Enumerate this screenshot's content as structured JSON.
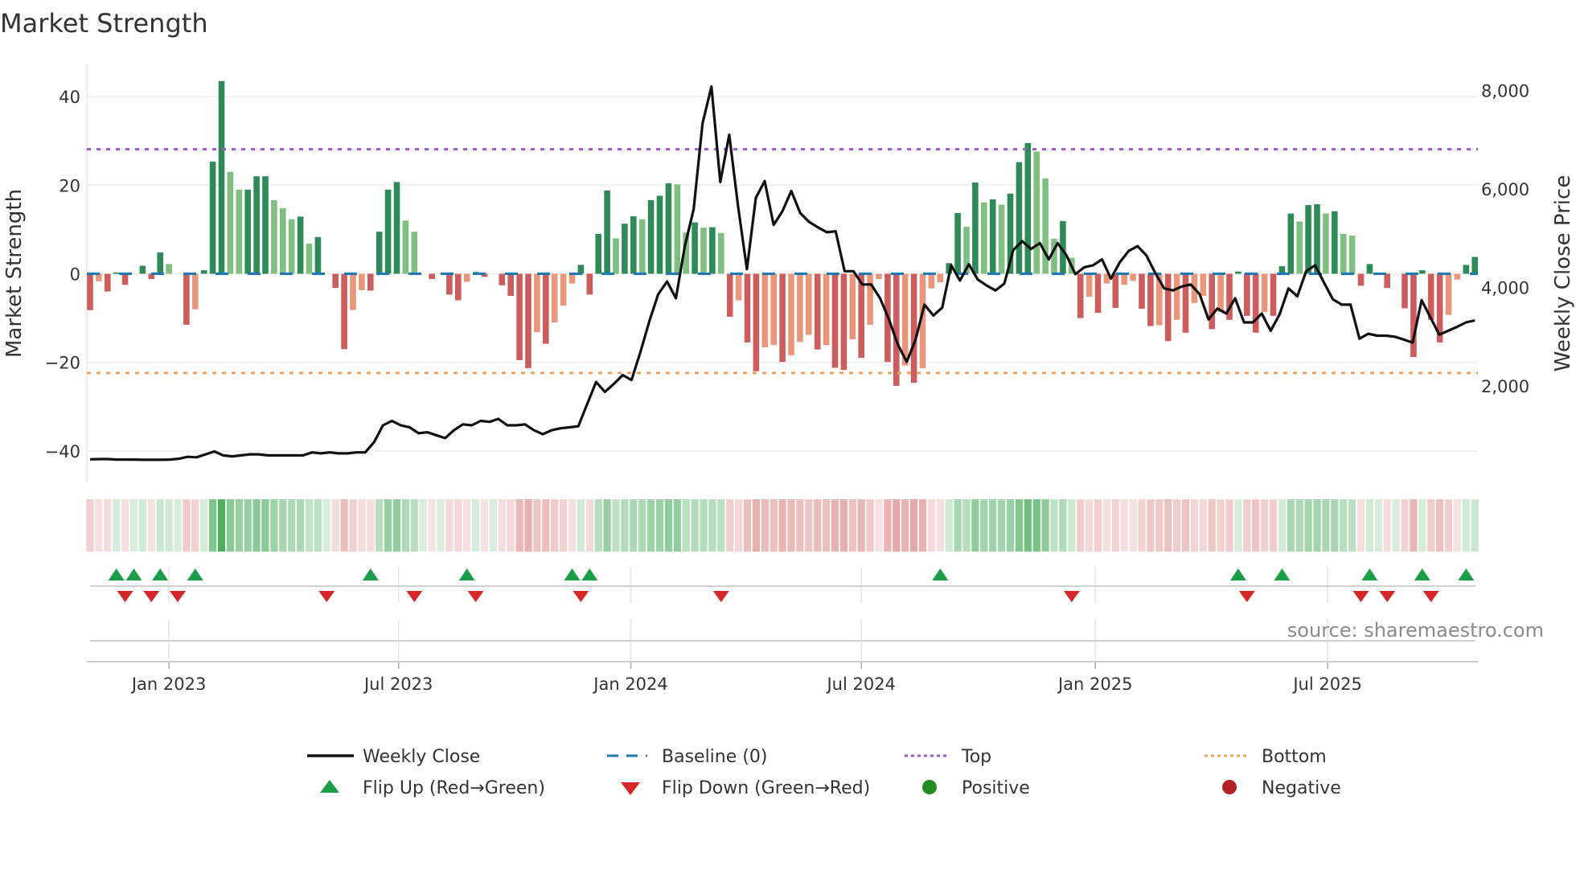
{
  "chart_data": {
    "type": "bar",
    "title": "Market Strength",
    "ylabel": "Market Strength",
    "y2label": "Weekly Close Price",
    "ylim": [
      -47,
      47
    ],
    "y2_ticks": [
      "8,000",
      "6,000",
      "4,000",
      "2,000"
    ],
    "y2_tick_values": [
      8000,
      6000,
      4000,
      2000
    ],
    "y_ticks": [
      "40",
      "20",
      "0",
      "−20",
      "−40"
    ],
    "y_tick_values": [
      40,
      20,
      0,
      -20,
      -40
    ],
    "x_ticks": [
      {
        "label": "Jan 2023",
        "week": 10
      },
      {
        "label": "Jul 2023",
        "week": 36.2
      },
      {
        "label": "Jan 2024",
        "week": 62.7
      },
      {
        "label": "Jul 2024",
        "week": 89
      },
      {
        "label": "Jan 2025",
        "week": 115.7
      },
      {
        "label": "Jul 2025",
        "week": 142.2
      }
    ],
    "top_level": 28.1,
    "bottom_level": -22.4,
    "strength": [
      -8.2,
      -1.7,
      -4,
      0.3,
      -2.5,
      0,
      1.8,
      -1.2,
      4.8,
      2.2,
      0,
      -11.5,
      -8,
      0.8,
      25.3,
      43.5,
      23,
      19,
      19,
      22,
      22,
      16.6,
      14.8,
      12.3,
      12.9,
      6.8,
      8.3,
      0,
      -3.2,
      -17,
      -8.2,
      -3.7,
      -3.8,
      9.5,
      19,
      20.7,
      12,
      9.5,
      0,
      -1.2,
      0,
      -4.7,
      -6,
      -1.8,
      0.4,
      -0.7,
      0,
      -2.6,
      -5,
      -19.5,
      -21.3,
      -13.2,
      -15.8,
      -11,
      -7.2,
      -2.2,
      2,
      -4.7,
      9,
      18.8,
      8,
      11.3,
      13,
      12.3,
      16.6,
      17.6,
      20.4,
      20.2,
      9.3,
      11.6,
      10.4,
      10.5,
      9.2,
      -9.7,
      -6,
      -15.5,
      -22,
      -16.6,
      -16.1,
      -19.9,
      -18.4,
      -15.4,
      -13.8,
      -17.1,
      -16.1,
      -21.2,
      -21.7,
      -14.8,
      -19,
      -11.5,
      -1.2,
      -19.9,
      -25.3,
      -20.7,
      -24.6,
      -21.3,
      -3.3,
      -1.9,
      2.4,
      13.7,
      10.6,
      20.6,
      16.1,
      16.8,
      15.6,
      18.1,
      25.2,
      29.5,
      27.6,
      21.5,
      7.9,
      11.9,
      3.6,
      -10,
      -5.2,
      -8.8,
      -2.2,
      -7.7,
      -2.5,
      -1.6,
      -7.9,
      -11.8,
      -11.6,
      -15.2,
      -10.4,
      -13.3,
      -6.6,
      -5,
      -12.5,
      -8.6,
      -10.4,
      0.5,
      -9.5,
      -13.3,
      -8.6,
      -9.5,
      1.7,
      13.6,
      11.8,
      15.5,
      15.7,
      13.6,
      14.1,
      9,
      8.6,
      -2.7,
      2.2,
      0,
      -3.2,
      0,
      -7.8,
      -18.8,
      0.8,
      -10.4,
      -15.5,
      -9.3,
      -1.3,
      2,
      3.8
    ],
    "weekly_close": [
      510,
      515,
      515,
      505,
      505,
      505,
      500,
      500,
      500,
      505,
      520,
      560,
      550,
      610,
      670,
      590,
      570,
      590,
      610,
      610,
      590,
      590,
      590,
      590,
      590,
      650,
      630,
      650,
      630,
      630,
      650,
      650,
      860,
      1200,
      1290,
      1200,
      1160,
      1040,
      1060,
      1000,
      940,
      1100,
      1220,
      1200,
      1290,
      1270,
      1330,
      1200,
      1200,
      1220,
      1100,
      1020,
      1100,
      1140,
      1160,
      1180,
      1630,
      2080,
      1880,
      2040,
      2220,
      2120,
      2690,
      3310,
      3860,
      4120,
      3780,
      4840,
      5590,
      7330,
      8080,
      6140,
      7100,
      5650,
      4370,
      5820,
      6160,
      5270,
      5550,
      5960,
      5510,
      5330,
      5220,
      5120,
      5140,
      4330,
      4330,
      4060,
      4060,
      3780,
      3350,
      2840,
      2490,
      2940,
      3650,
      3430,
      3590,
      4450,
      4140,
      4470,
      4160,
      4040,
      3940,
      4080,
      4760,
      4940,
      4780,
      4900,
      4570,
      4900,
      4650,
      4270,
      4410,
      4450,
      4570,
      4180,
      4510,
      4740,
      4840,
      4650,
      4290,
      3980,
      3940,
      4020,
      4060,
      3860,
      3350,
      3570,
      3470,
      3780,
      3290,
      3290,
      3470,
      3120,
      3450,
      3980,
      3820,
      4330,
      4450,
      4100,
      3760,
      3650,
      3650,
      2960,
      3060,
      3020,
      3020,
      3000,
      2940,
      2880,
      3740,
      3390,
      3040,
      3120,
      3200,
      3290,
      3330
    ],
    "flip_up_weeks": [
      4,
      6,
      9,
      13,
      33,
      44,
      56,
      58,
      98,
      132,
      137,
      147,
      153,
      158
    ],
    "flip_down_weeks": [
      5,
      8,
      11,
      28,
      38,
      45,
      57,
      73,
      113,
      133,
      146,
      149,
      154
    ],
    "colors": {
      "pos_strong": "#2e8b57",
      "pos_weak": "#7fbf7f",
      "neg_strong": "#cd5c5c",
      "neg_weak": "#e9967a",
      "baseline": "#1f77b4",
      "top": "#9b59d0",
      "bottom": "#f0a060",
      "flip_up": "#1a9e48",
      "flip_down": "#d62728",
      "positive": "#228b22",
      "negative": "#b22222"
    },
    "legend": {
      "weekly_close": "Weekly Close",
      "baseline": "Baseline (0)",
      "top": "Top",
      "bottom": "Bottom",
      "flip_up": "Flip Up (Red→Green)",
      "flip_down": "Flip Down (Green→Red)",
      "positive": "Positive",
      "negative": "Negative"
    },
    "source": "source: sharemaestro.com"
  }
}
